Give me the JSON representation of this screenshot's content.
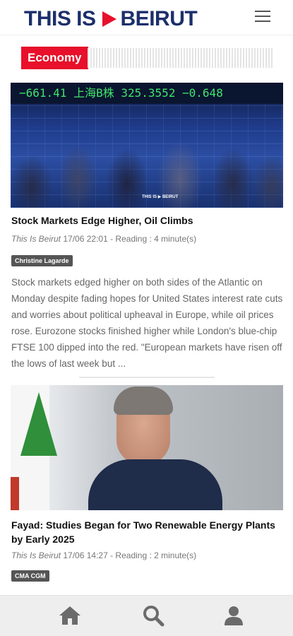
{
  "header": {
    "logo_text_left": "THIS IS",
    "logo_text_right": "BEIRUT",
    "menu_icon": "hamburger-menu-icon"
  },
  "section": {
    "label": "Economy"
  },
  "articles": [
    {
      "title": "Stock Markets Edge Higher, Oil Climbs",
      "source": "This Is Beirut",
      "datetime": "17/06 22:01 - Reading : 4 minute(s)",
      "tag": "Christine Lagarde",
      "image_ticker": "−661.41  上海B株       325.3552       −0.648",
      "image_watermark": "THIS IS ▶ BEIRUT",
      "excerpt": "Stock markets edged higher on both sides of the Atlantic on Monday despite fading hopes for United States interest rate cuts and worries about political upheaval in Europe, while oil prices rose. Eurozone stocks finished higher while London's blue-chip FTSE 100 dipped into the red. \"European markets have risen off the lows of last week but ..."
    },
    {
      "title": "Fayad: Studies Began for Two Renewable Energy Plants by Early 2025",
      "source": "This Is Beirut",
      "datetime": "17/06 14:27 - Reading : 2 minute(s)",
      "tag": "CMA CGM"
    }
  ],
  "bottom_nav": {
    "items": [
      {
        "icon": "home-icon"
      },
      {
        "icon": "search-icon"
      },
      {
        "icon": "user-icon"
      }
    ]
  },
  "colors": {
    "brand_navy": "#1c2f6b",
    "brand_red": "#e8102a",
    "tag_bg": "#555555",
    "nav_bg": "#eeeeee"
  }
}
